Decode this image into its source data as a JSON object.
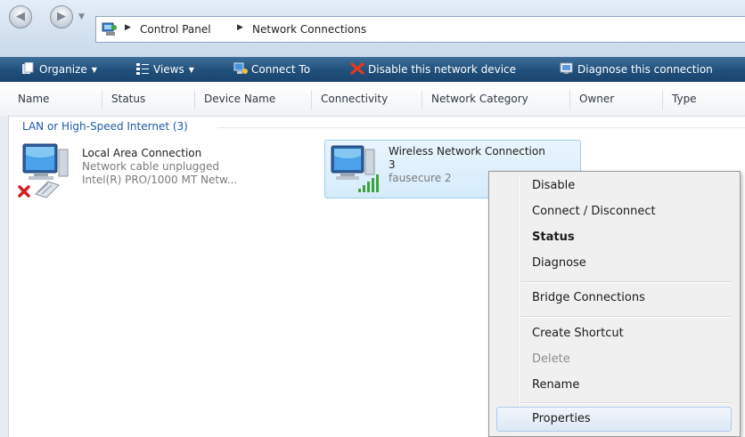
{
  "address_bar": {
    "breadcrumbs": [
      "Control Panel",
      "Network Connections"
    ],
    "icons": {
      "back": "back-arrow-icon",
      "forward": "forward-arrow-icon",
      "location": "network-connections-folder-icon"
    }
  },
  "toolbar": {
    "organize": "Organize",
    "views": "Views",
    "connect_to": "Connect To",
    "disable_device": "Disable this network device",
    "diagnose": "Diagnose this connection"
  },
  "columns": [
    "Name",
    "Status",
    "Device Name",
    "Connectivity",
    "Network Category",
    "Owner",
    "Type"
  ],
  "group": {
    "label": "LAN or High-Speed Internet (3)"
  },
  "connections": [
    {
      "name": "Local Area Connection",
      "status": "Network cable unplugged",
      "device": "Intel(R) PRO/1000 MT Netw..."
    },
    {
      "name": "Wireless Network Connection",
      "name_line2": "3",
      "network": "fausecure  2",
      "selected": true
    }
  ],
  "context_menu": {
    "items": [
      {
        "label": "Disable"
      },
      {
        "label": "Connect / Disconnect"
      },
      {
        "label": "Status",
        "bold": true
      },
      {
        "label": "Diagnose"
      },
      {
        "label": "Bridge Connections"
      },
      {
        "label": "Create Shortcut"
      },
      {
        "label": "Delete",
        "disabled": true
      },
      {
        "label": "Rename"
      },
      {
        "label": "Properties",
        "highlighted": true
      }
    ]
  },
  "colors": {
    "toolbar_bg": "#1f4f7a",
    "group_header": "#1e5aa8",
    "selection_bg": "#d5ebfb",
    "disconnected_x": "#d42020",
    "signal_green": "#3aa63a"
  }
}
